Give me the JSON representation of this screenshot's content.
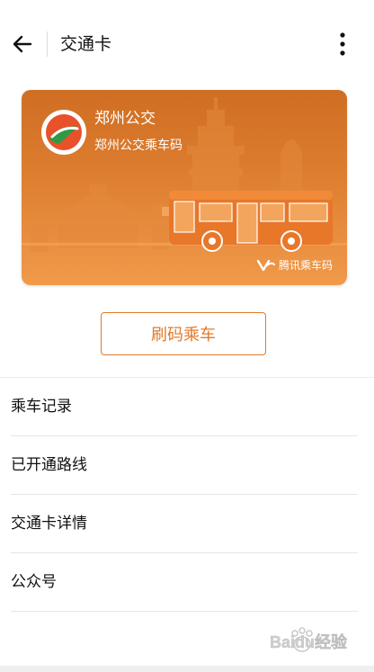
{
  "header": {
    "title": "交通卡",
    "back_icon": "arrow-left-icon",
    "more_icon": "more-vertical-icon"
  },
  "card": {
    "name": "郑州公交",
    "subtitle": "郑州公交乘车码",
    "brand": "腾讯乘车码",
    "logo_icon": "zhengzhou-bus-logo-icon",
    "brand_icon": "tencent-ride-code-icon"
  },
  "scan_button": {
    "label": "刷码乘车"
  },
  "menu": {
    "items": [
      {
        "label": "乘车记录"
      },
      {
        "label": "已开通路线"
      },
      {
        "label": "交通卡详情"
      },
      {
        "label": "公众号"
      }
    ]
  },
  "watermark": {
    "text": "Baidu经验"
  },
  "colors": {
    "accent": "#e07a2c",
    "card_top": "#cf6e22",
    "card_bottom": "#f09a4a"
  }
}
